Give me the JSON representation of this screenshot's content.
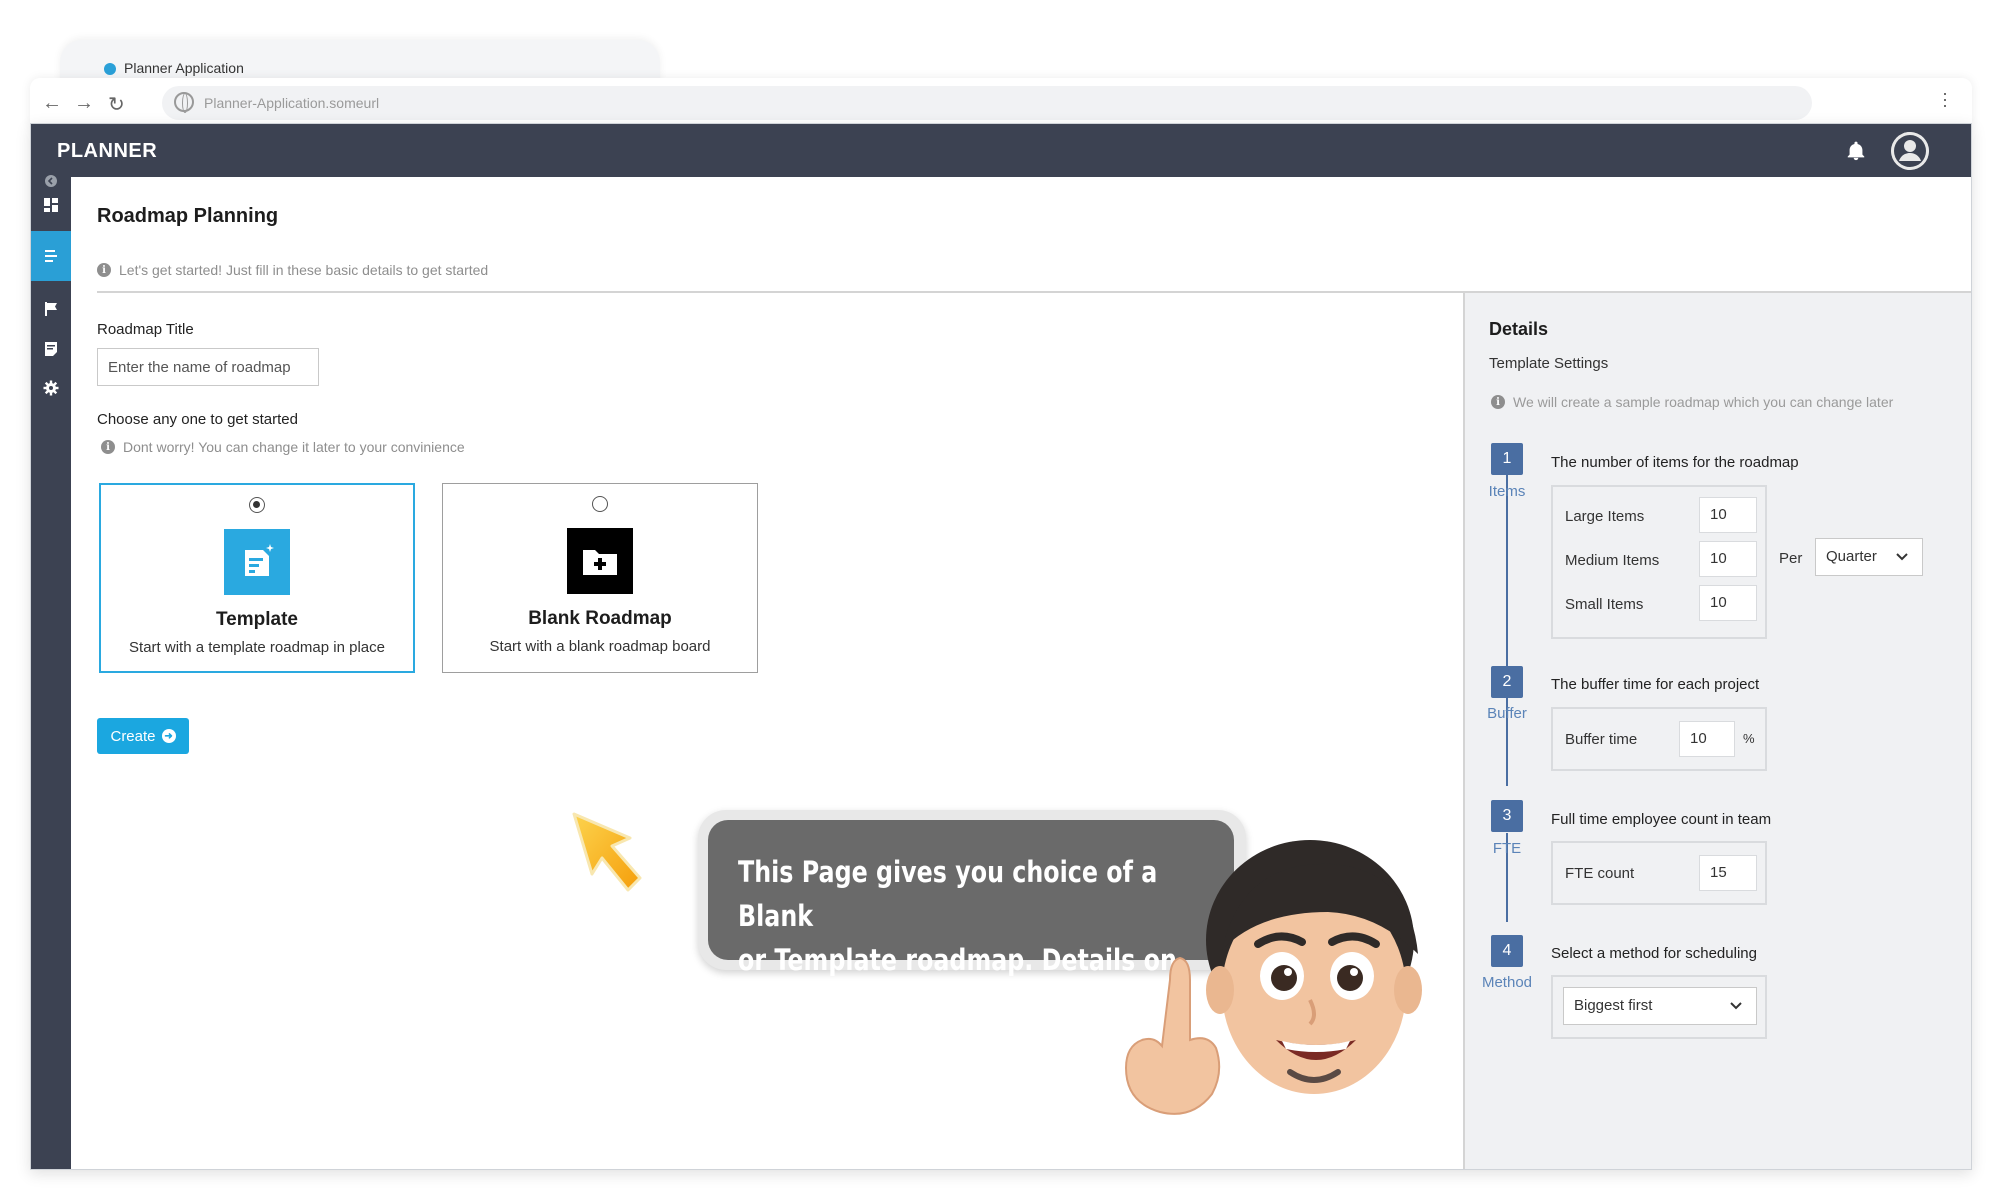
{
  "browser": {
    "tab_title": "Planner Application",
    "url": "Planner-Application.someurl"
  },
  "app": {
    "brand": "PLANNER"
  },
  "page": {
    "title": "Roadmap Planning",
    "hint": "Let's get started! Just fill in these basic details to get started"
  },
  "form": {
    "title_label": "Roadmap Title",
    "title_placeholder": "Enter the name of roadmap",
    "choose_label": "Choose any one to get started",
    "choose_hint": "Dont worry! You can change it later to your convinience",
    "options": [
      {
        "title": "Template",
        "subtitle": "Start with a template roadmap in place",
        "selected": true
      },
      {
        "title": "Blank Roadmap",
        "subtitle": "Start with a blank roadmap board",
        "selected": false
      }
    ],
    "create_label": "Create"
  },
  "details": {
    "title": "Details",
    "subtitle": "Template Settings",
    "hint": "We will create a sample roadmap which you can change later",
    "steps": [
      {
        "num": "1",
        "label": "Items",
        "heading": "The number of items for the roadmap"
      },
      {
        "num": "2",
        "label": "Buffer",
        "heading": "The buffer time for each project"
      },
      {
        "num": "3",
        "label": "FTE",
        "heading": "Full time employee count in team"
      },
      {
        "num": "4",
        "label": "Method",
        "heading": "Select a method for scheduling"
      }
    ],
    "items": {
      "large_label": "Large Items",
      "large_value": "10",
      "medium_label": "Medium Items",
      "medium_value": "10",
      "small_label": "Small Items",
      "small_value": "10",
      "per_label": "Per",
      "per_value": "Quarter"
    },
    "buffer": {
      "label": "Buffer time",
      "value": "10",
      "unit": "%"
    },
    "fte": {
      "label": "FTE count",
      "value": "15"
    },
    "method": {
      "value": "Biggest first"
    }
  },
  "callout": {
    "line1": "This Page gives you choice of a Blank",
    "line2": "or Template roadmap. Details on right!"
  },
  "colors": {
    "appbar": "#3c4252",
    "accent": "#1ba7e0",
    "step": "#4a6ea2"
  }
}
